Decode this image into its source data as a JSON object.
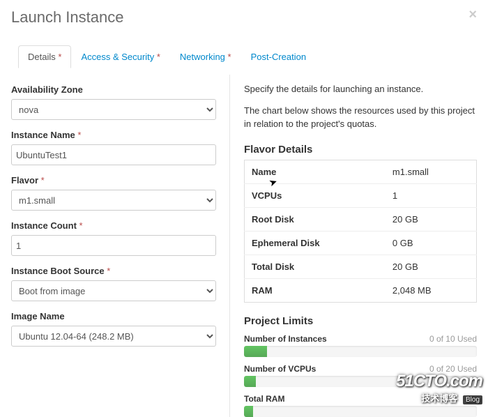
{
  "header": {
    "title": "Launch Instance"
  },
  "tabs": [
    {
      "label": "Details",
      "required": true,
      "active": true
    },
    {
      "label": "Access & Security",
      "required": true,
      "active": false
    },
    {
      "label": "Networking",
      "required": true,
      "active": false
    },
    {
      "label": "Post-Creation",
      "required": false,
      "active": false
    }
  ],
  "form": {
    "availability_zone": {
      "label": "Availability Zone",
      "value": "nova"
    },
    "instance_name": {
      "label": "Instance Name",
      "value": "UbuntuTest1",
      "required": true
    },
    "flavor": {
      "label": "Flavor",
      "value": "m1.small",
      "required": true
    },
    "instance_count": {
      "label": "Instance Count",
      "value": "1",
      "required": true
    },
    "boot_source": {
      "label": "Instance Boot Source",
      "value": "Boot from image",
      "required": true
    },
    "image_name": {
      "label": "Image Name",
      "value": "Ubuntu 12.04-64 (248.2 MB)"
    }
  },
  "help": {
    "line1": "Specify the details for launching an instance.",
    "line2": "The chart below shows the resources used by this project in relation to the project's quotas."
  },
  "flavor_details": {
    "heading": "Flavor Details",
    "rows": [
      {
        "label": "Name",
        "value": "m1.small"
      },
      {
        "label": "VCPUs",
        "value": "1"
      },
      {
        "label": "Root Disk",
        "value": "20 GB"
      },
      {
        "label": "Ephemeral Disk",
        "value": "0 GB"
      },
      {
        "label": "Total Disk",
        "value": "20 GB"
      },
      {
        "label": "RAM",
        "value": "2,048 MB"
      }
    ]
  },
  "project_limits": {
    "heading": "Project Limits",
    "items": [
      {
        "label": "Number of Instances",
        "used_text": "0 of 10 Used",
        "percent": 10
      },
      {
        "label": "Number of VCPUs",
        "used_text": "0 of 20 Used",
        "percent": 5
      },
      {
        "label": "Total RAM",
        "used_text": "",
        "percent": 4
      }
    ]
  },
  "watermark": {
    "big": "51CTO.com",
    "small": "技术博客",
    "blog": "Blog"
  },
  "chart_data": {
    "type": "bar",
    "title": "Project Limits",
    "series": [
      {
        "name": "Number of Instances",
        "used": 0,
        "limit": 10,
        "new": 1
      },
      {
        "name": "Number of VCPUs",
        "used": 0,
        "limit": 20,
        "new": 1
      },
      {
        "name": "Total RAM (MB)",
        "used": 0,
        "limit": 51200,
        "new": 2048
      }
    ]
  }
}
